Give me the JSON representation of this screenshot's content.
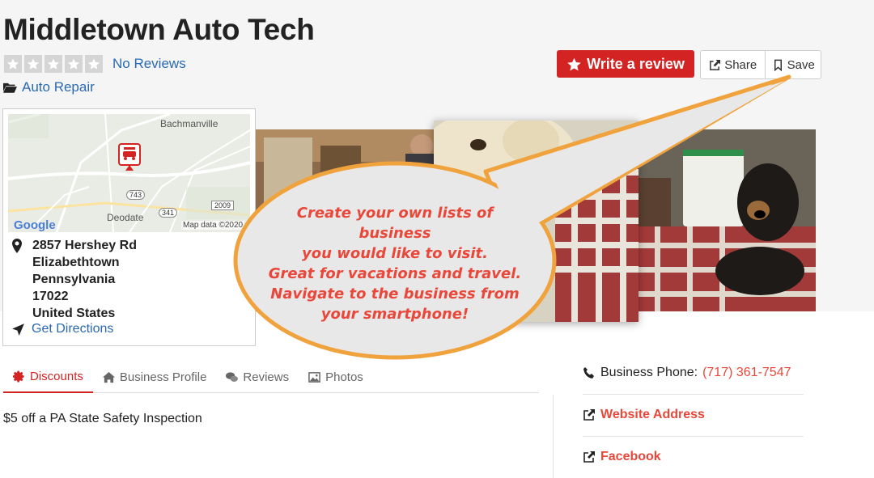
{
  "business": {
    "name": "Middletown Auto Tech",
    "reviews_label": "No Reviews",
    "rating": 0,
    "max_rating": 5,
    "category": "Auto Repair"
  },
  "actions": {
    "write_review": "Write a review",
    "share": "Share",
    "save": "Save"
  },
  "map": {
    "labels": {
      "town_north": "Bachmanville",
      "town_south": "Deodate",
      "route_743": "743",
      "route_341": "341",
      "route_2009": "2009",
      "attribution": "Map data ©2020",
      "logo": "Google"
    }
  },
  "address": {
    "street": "2857 Hershey Rd",
    "city": "Elizabethtown",
    "state": "Pennsylvania",
    "zip": "17022",
    "country": "United States",
    "directions_label": "Get Directions"
  },
  "callout": {
    "lines": [
      "Create your own lists of",
      "business",
      "you would like to visit.",
      "Great for vacations and travel.",
      "Navigate to the business from",
      "your smartphone!"
    ]
  },
  "tabs": [
    {
      "label": "Discounts",
      "icon": "gear-icon",
      "active": true
    },
    {
      "label": "Business Profile",
      "icon": "home-icon",
      "active": false
    },
    {
      "label": "Reviews",
      "icon": "comments-icon",
      "active": false
    },
    {
      "label": "Photos",
      "icon": "image-icon",
      "active": false
    }
  ],
  "discount": {
    "text": "$5 off a PA State Safety Inspection"
  },
  "sidebar": {
    "phone_label": "Business Phone:",
    "phone_value": "(717) 361-7547",
    "website_label": "Website Address",
    "facebook_label": "Facebook"
  },
  "colors": {
    "brand_red": "#d32323",
    "link_blue": "#2a6ab0",
    "callout_orange": "#f0a23c",
    "callout_text": "#e8473a"
  }
}
